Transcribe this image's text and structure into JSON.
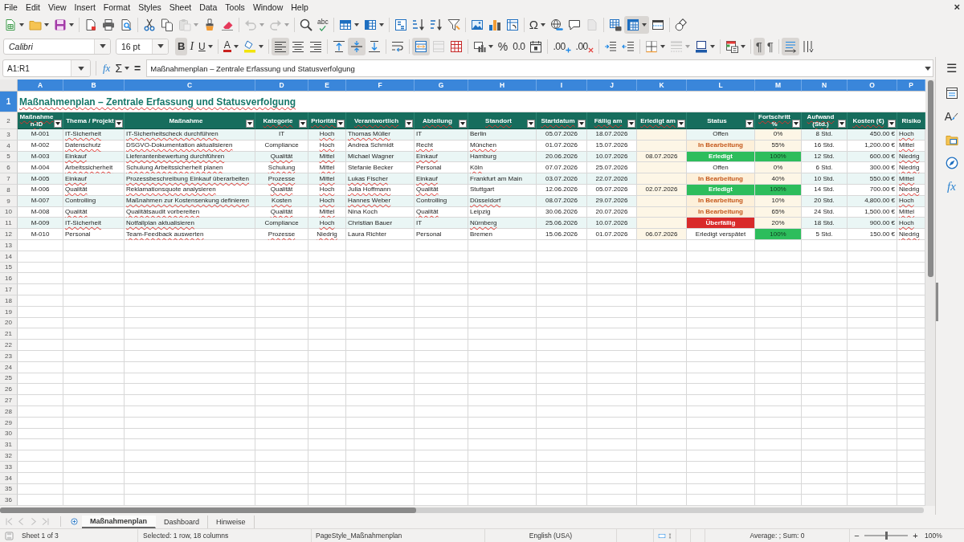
{
  "menu_bar": {
    "items": [
      "File",
      "Edit",
      "View",
      "Insert",
      "Format",
      "Styles",
      "Sheet",
      "Data",
      "Tools",
      "Window",
      "Help"
    ],
    "close": "×"
  },
  "standard_toolbar": [
    [
      {
        "kind": "new",
        "dropdown": true,
        "pressed": false,
        "disabled": false
      },
      {
        "kind": "open",
        "dropdown": true,
        "pressed": false,
        "disabled": false
      },
      {
        "kind": "save",
        "dropdown": true,
        "pressed": false,
        "disabled": false
      }
    ],
    [
      {
        "kind": "pdf",
        "dropdown": false,
        "pressed": false,
        "disabled": false
      },
      {
        "kind": "print",
        "dropdown": false,
        "pressed": false,
        "disabled": false
      },
      {
        "kind": "preview",
        "dropdown": false,
        "pressed": false,
        "disabled": false
      }
    ],
    [
      {
        "kind": "cut",
        "dropdown": false,
        "pressed": false,
        "disabled": false
      },
      {
        "kind": "copy",
        "dropdown": false,
        "pressed": false,
        "disabled": false
      },
      {
        "kind": "paste",
        "dropdown": true,
        "pressed": false,
        "disabled": true
      },
      {
        "kind": "clone",
        "dropdown": false,
        "pressed": false,
        "disabled": false
      },
      {
        "kind": "clear",
        "dropdown": false,
        "pressed": false,
        "disabled": false
      }
    ],
    [
      {
        "kind": "undo",
        "dropdown": true,
        "pressed": false,
        "disabled": true
      },
      {
        "kind": "redo",
        "dropdown": true,
        "pressed": false,
        "disabled": true
      }
    ],
    [
      {
        "kind": "find",
        "dropdown": false,
        "pressed": false,
        "disabled": false
      },
      {
        "kind": "spelling",
        "label": "abc",
        "dropdown": false,
        "pressed": false,
        "disabled": false
      }
    ],
    [
      {
        "kind": "rows",
        "dropdown": true,
        "pressed": false,
        "disabled": false
      },
      {
        "kind": "columns",
        "dropdown": true,
        "pressed": false,
        "disabled": false
      }
    ],
    [
      {
        "kind": "sort",
        "dropdown": false,
        "pressed": false,
        "disabled": false
      },
      {
        "kind": "sort_ascending",
        "dropdown": false,
        "pressed": false,
        "disabled": false
      },
      {
        "kind": "sort_descending",
        "dropdown": false,
        "pressed": false,
        "disabled": false
      },
      {
        "kind": "autofilter",
        "dropdown": false,
        "pressed": false,
        "disabled": false
      }
    ],
    [
      {
        "kind": "image",
        "dropdown": false,
        "pressed": false,
        "disabled": false
      },
      {
        "kind": "chart",
        "dropdown": false,
        "pressed": false,
        "disabled": false
      },
      {
        "kind": "pivot",
        "dropdown": false,
        "pressed": false,
        "disabled": false
      }
    ],
    [
      {
        "kind": "special_character",
        "label": "Ω",
        "dropdown": true,
        "pressed": false,
        "disabled": false
      },
      {
        "kind": "hyperlink",
        "dropdown": false,
        "pressed": false,
        "disabled": false
      },
      {
        "kind": "comment",
        "dropdown": false,
        "pressed": false,
        "disabled": false
      },
      {
        "kind": "header_footer",
        "dropdown": false,
        "pressed": false,
        "disabled": true
      }
    ],
    [
      {
        "kind": "print_area",
        "dropdown": false,
        "pressed": false,
        "disabled": false
      },
      {
        "kind": "freeze",
        "dropdown": true,
        "pressed": true,
        "disabled": false
      },
      {
        "kind": "split",
        "dropdown": false,
        "pressed": false,
        "disabled": false
      }
    ],
    [
      {
        "kind": "draw",
        "dropdown": false,
        "pressed": false,
        "disabled": false
      }
    ]
  ],
  "formatting_toolbar": {
    "font_name": "Calibri",
    "font_size": "16 pt",
    "groups": [
      [
        {
          "kind": "bold",
          "label": "B",
          "dropdown": false,
          "pressed": true,
          "disabled": false
        },
        {
          "kind": "italic",
          "label": "I",
          "dropdown": false,
          "pressed": false,
          "disabled": false
        },
        {
          "kind": "underline",
          "label": "U",
          "dropdown": true,
          "pressed": false,
          "disabled": false
        }
      ],
      [
        {
          "kind": "font_color",
          "label": "A",
          "dropdown": true,
          "pressed": false,
          "disabled": false
        },
        {
          "kind": "highlight",
          "dropdown": true,
          "pressed": false,
          "disabled": false
        }
      ],
      [
        {
          "kind": "align_left",
          "dropdown": false,
          "pressed": true,
          "disabled": false
        },
        {
          "kind": "align_center",
          "dropdown": false,
          "pressed": false,
          "disabled": false
        },
        {
          "kind": "align_right",
          "dropdown": false,
          "pressed": false,
          "disabled": false
        }
      ],
      [
        {
          "kind": "align_top",
          "dropdown": false,
          "pressed": false,
          "disabled": false
        },
        {
          "kind": "align_middle",
          "dropdown": false,
          "pressed": true,
          "disabled": false
        },
        {
          "kind": "align_bottom",
          "dropdown": false,
          "pressed": false,
          "disabled": false
        }
      ],
      [
        {
          "kind": "wrap",
          "dropdown": false,
          "pressed": false,
          "disabled": false
        }
      ],
      [
        {
          "kind": "merge_center",
          "dropdown": false,
          "pressed": true,
          "disabled": false
        },
        {
          "kind": "merge",
          "dropdown": false,
          "pressed": false,
          "disabled": true
        },
        {
          "kind": "unmerge",
          "dropdown": false,
          "pressed": false,
          "disabled": false
        }
      ],
      [
        {
          "kind": "currency",
          "dropdown": true,
          "pressed": false,
          "disabled": false
        },
        {
          "kind": "percent",
          "label": "%",
          "dropdown": false,
          "pressed": false,
          "disabled": false
        },
        {
          "kind": "number",
          "label": "0.0",
          "dropdown": false,
          "pressed": false,
          "disabled": false
        },
        {
          "kind": "date",
          "dropdown": false,
          "pressed": false,
          "disabled": false
        }
      ],
      [
        {
          "kind": "add_decimal",
          "label": ".00",
          "dropdown": false,
          "pressed": false,
          "disabled": false
        },
        {
          "kind": "delete_decimal",
          "label": ".00",
          "dropdown": false,
          "pressed": false,
          "disabled": false
        }
      ],
      [
        {
          "kind": "indent",
          "dropdown": false,
          "pressed": false,
          "disabled": false
        },
        {
          "kind": "outdent",
          "dropdown": false,
          "pressed": false,
          "disabled": false
        }
      ],
      [
        {
          "kind": "borders",
          "dropdown": true,
          "pressed": false,
          "disabled": false
        },
        {
          "kind": "border_style",
          "dropdown": true,
          "pressed": false,
          "disabled": true
        },
        {
          "kind": "border_color",
          "dropdown": true,
          "pressed": false,
          "disabled": false
        }
      ],
      [
        {
          "kind": "conditional",
          "dropdown": true,
          "pressed": false,
          "disabled": false
        }
      ],
      [
        {
          "kind": "paragraph_ltr",
          "label": "¶",
          "dropdown": false,
          "pressed": true,
          "disabled": false
        },
        {
          "kind": "paragraph_rtl",
          "label": "¶",
          "dropdown": false,
          "pressed": false,
          "disabled": false
        }
      ],
      [
        {
          "kind": "text_ltr",
          "dropdown": false,
          "pressed": true,
          "disabled": false
        },
        {
          "kind": "text_vertical",
          "dropdown": false,
          "pressed": false,
          "disabled": false
        }
      ]
    ]
  },
  "formula_bar": {
    "name_box": "A1:R1",
    "function_wizard": "fx",
    "sum": "Σ",
    "equals": "=",
    "content": "Maßnahmenplan – Zentrale Erfassung und Statusverfolgung"
  },
  "sidebar": {
    "menu": "☰",
    "buttons": [
      {
        "kind": "properties"
      },
      {
        "kind": "styles",
        "label": "A"
      },
      {
        "kind": "gallery"
      },
      {
        "kind": "navigator"
      },
      {
        "kind": "functions",
        "label": "fx"
      }
    ]
  },
  "sheet": {
    "column_headers": [
      {
        "label": "A",
        "selected": true
      },
      {
        "label": "B",
        "selected": true
      },
      {
        "label": "C",
        "selected": true
      },
      {
        "label": "D",
        "selected": true
      },
      {
        "label": "E",
        "selected": true
      },
      {
        "label": "F",
        "selected": true
      },
      {
        "label": "G",
        "selected": true
      },
      {
        "label": "H",
        "selected": true
      },
      {
        "label": "I",
        "selected": true
      },
      {
        "label": "J",
        "selected": true
      },
      {
        "label": "K",
        "selected": true
      },
      {
        "label": "L",
        "selected": true
      },
      {
        "label": "M",
        "selected": true
      },
      {
        "label": "N",
        "selected": true
      },
      {
        "label": "O",
        "selected": true
      },
      {
        "label": "P",
        "selected": true
      }
    ],
    "row_headers": [
      {
        "label": "1",
        "selected": true
      },
      {
        "label": "2",
        "selected": false
      },
      {
        "label": "3",
        "selected": false
      },
      {
        "label": "4",
        "selected": false
      },
      {
        "label": "5",
        "selected": false
      },
      {
        "label": "6",
        "selected": false
      },
      {
        "label": "7",
        "selected": false
      },
      {
        "label": "8",
        "selected": false
      },
      {
        "label": "9",
        "selected": false
      },
      {
        "label": "10",
        "selected": false
      },
      {
        "label": "11",
        "selected": false
      },
      {
        "label": "12",
        "selected": false
      },
      {
        "label": "13",
        "selected": false
      },
      {
        "label": "14",
        "selected": false
      },
      {
        "label": "15",
        "selected": false
      },
      {
        "label": "16",
        "selected": false
      },
      {
        "label": "17",
        "selected": false
      },
      {
        "label": "18",
        "selected": false
      },
      {
        "label": "19",
        "selected": false
      },
      {
        "label": "20",
        "selected": false
      },
      {
        "label": "21",
        "selected": false
      },
      {
        "label": "22",
        "selected": false
      },
      {
        "label": "23",
        "selected": false
      },
      {
        "label": "24",
        "selected": false
      },
      {
        "label": "25",
        "selected": false
      },
      {
        "label": "26",
        "selected": false
      },
      {
        "label": "27",
        "selected": false
      },
      {
        "label": "28",
        "selected": false
      },
      {
        "label": "29",
        "selected": false
      },
      {
        "label": "30",
        "selected": false
      },
      {
        "label": "31",
        "selected": false
      },
      {
        "label": "32",
        "selected": false
      },
      {
        "label": "33",
        "selected": false
      },
      {
        "label": "34",
        "selected": false
      },
      {
        "label": "35",
        "selected": false
      },
      {
        "label": "36",
        "selected": false
      }
    ],
    "title": {
      "text": "Maßnahmenplan – Zentrale Erfassung und Statusverfolgung",
      "spell_error": true
    },
    "headers": [
      {
        "text": "Maßnahmen-ID",
        "filter": true,
        "spell_error": true
      },
      {
        "text": "Thema / Projekt",
        "filter": true,
        "spell_error": false
      },
      {
        "text": "Maßnahme",
        "filter": true,
        "spell_error": false
      },
      {
        "text": "Kategorie",
        "filter": true,
        "spell_error": true
      },
      {
        "text": "Priorität",
        "filter": true,
        "spell_error": true
      },
      {
        "text": "Verantwortlich",
        "filter": true,
        "spell_error": true
      },
      {
        "text": "Abteilung",
        "filter": true,
        "spell_error": true
      },
      {
        "text": "Standort",
        "filter": true,
        "spell_error": true
      },
      {
        "text": "Startdatum",
        "filter": true,
        "spell_error": true
      },
      {
        "text": "Fällig am",
        "filter": true,
        "spell_error": true
      },
      {
        "text": "Erledigt am",
        "filter": true,
        "spell_error": true
      },
      {
        "text": "Status",
        "filter": true,
        "spell_error": false
      },
      {
        "text": "Fortschritt %",
        "filter": true,
        "spell_error": true
      },
      {
        "text": "Aufwand (Std.)",
        "filter": true,
        "spell_error": true
      },
      {
        "text": "Kosten (€)",
        "filter": true,
        "spell_error": true
      },
      {
        "text": "Risiko",
        "filter": false,
        "spell_error": false
      }
    ],
    "rows": [
      {
        "id": {
          "text": "M-001",
          "spell_error": false
        },
        "topic": {
          "text": "IT-Sicherheit",
          "spell_error": true
        },
        "measure": {
          "text": "IT-Sicherheitscheck durchführen",
          "spell_error": true
        },
        "category": {
          "text": "IT",
          "spell_error": false
        },
        "priority": {
          "text": "Hoch",
          "spell_error": true
        },
        "owner": {
          "text": "Thomas Müller",
          "spell_error": true
        },
        "department": {
          "text": "IT",
          "spell_error": false
        },
        "location": {
          "text": "Berlin",
          "spell_error": false
        },
        "start": {
          "text": "05.07.2026",
          "spell_error": false
        },
        "due": {
          "text": "18.07.2026",
          "spell_error": false
        },
        "status": {
          "text": "Offen",
          "spell_error": false,
          "kind": "open"
        },
        "progress": {
          "text": "0%",
          "spell_error": false,
          "complete": false
        },
        "effort": {
          "text": "8 Std.",
          "spell_error": false
        },
        "cost": {
          "text": "450.00 €",
          "spell_error": false
        },
        "risk": {
          "text": "Hoch",
          "spell_error": true
        }
      },
      {
        "id": {
          "text": "M-002",
          "spell_error": false
        },
        "topic": {
          "text": "Datenschutz",
          "spell_error": true
        },
        "measure": {
          "text": "DSGVO-Dokumentation aktualisieren",
          "spell_error": true
        },
        "category": {
          "text": "Compliance",
          "spell_error": false
        },
        "priority": {
          "text": "Hoch",
          "spell_error": true
        },
        "owner": {
          "text": "Andrea Schmidt",
          "spell_error": false
        },
        "department": {
          "text": "Recht",
          "spell_error": true
        },
        "location": {
          "text": "München",
          "spell_error": true
        },
        "start": {
          "text": "01.07.2026",
          "spell_error": false
        },
        "due": {
          "text": "15.07.2026",
          "spell_error": false
        },
        "status": {
          "text": "In Bearbeitung",
          "spell_error": false,
          "kind": "in_progress"
        },
        "progress": {
          "text": "55%",
          "spell_error": false,
          "complete": false
        },
        "effort": {
          "text": "16 Std.",
          "spell_error": false
        },
        "cost": {
          "text": "1,200.00 €",
          "spell_error": false
        },
        "risk": {
          "text": "Mittel",
          "spell_error": true
        }
      },
      {
        "id": {
          "text": "M-003",
          "spell_error": false
        },
        "topic": {
          "text": "Einkauf",
          "spell_error": true
        },
        "measure": {
          "text": "Lieferantenbewertung durchführen",
          "spell_error": true
        },
        "category": {
          "text": "Qualität",
          "spell_error": true
        },
        "priority": {
          "text": "Mittel",
          "spell_error": true
        },
        "owner": {
          "text": "Michael Wagner",
          "spell_error": false
        },
        "department": {
          "text": "Einkauf",
          "spell_error": true
        },
        "location": {
          "text": "Hamburg",
          "spell_error": false
        },
        "start": {
          "text": "20.06.2026",
          "spell_error": false
        },
        "due": {
          "text": "10.07.2026",
          "spell_error": false
        },
        "done_on": {
          "text": "08.07.2026",
          "spell_error": false
        },
        "status": {
          "text": "Erledigt",
          "spell_error": false,
          "kind": "done"
        },
        "progress": {
          "text": "100%",
          "spell_error": false,
          "complete": true
        },
        "effort": {
          "text": "12 Std.",
          "spell_error": false
        },
        "cost": {
          "text": "600.00 €",
          "spell_error": false
        },
        "risk": {
          "text": "Niedrig",
          "spell_error": true
        }
      },
      {
        "id": {
          "text": "M-004",
          "spell_error": false
        },
        "topic": {
          "text": "Arbeitssicherheit",
          "spell_error": true
        },
        "measure": {
          "text": "Schulung Arbeitssicherheit planen",
          "spell_error": true
        },
        "category": {
          "text": "Schulung",
          "spell_error": true
        },
        "priority": {
          "text": "Mittel",
          "spell_error": true
        },
        "owner": {
          "text": "Stefanie Becker",
          "spell_error": false
        },
        "department": {
          "text": "Personal",
          "spell_error": false
        },
        "location": {
          "text": "Köln",
          "spell_error": true
        },
        "start": {
          "text": "07.07.2026",
          "spell_error": false
        },
        "due": {
          "text": "25.07.2026",
          "spell_error": false
        },
        "status": {
          "text": "Offen",
          "spell_error": false,
          "kind": "open"
        },
        "progress": {
          "text": "0%",
          "spell_error": false,
          "complete": false
        },
        "effort": {
          "text": "6 Std.",
          "spell_error": false
        },
        "cost": {
          "text": "300.00 €",
          "spell_error": false
        },
        "risk": {
          "text": "Niedrig",
          "spell_error": true
        }
      },
      {
        "id": {
          "text": "M-005",
          "spell_error": false
        },
        "topic": {
          "text": "Einkauf",
          "spell_error": true
        },
        "measure": {
          "text": "Prozessbeschreibung Einkauf überarbeiten",
          "spell_error": true
        },
        "category": {
          "text": "Prozesse",
          "spell_error": true
        },
        "priority": {
          "text": "Mittel",
          "spell_error": true
        },
        "owner": {
          "text": "Lukas Fischer",
          "spell_error": true
        },
        "department": {
          "text": "Einkauf",
          "spell_error": true
        },
        "location": {
          "text": "Frankfurt am Main",
          "spell_error": false
        },
        "start": {
          "text": "03.07.2026",
          "spell_error": false
        },
        "due": {
          "text": "22.07.2026",
          "spell_error": false
        },
        "status": {
          "text": "In Bearbeitung",
          "spell_error": false,
          "kind": "in_progress"
        },
        "progress": {
          "text": "40%",
          "spell_error": false,
          "complete": false
        },
        "effort": {
          "text": "10 Std.",
          "spell_error": false
        },
        "cost": {
          "text": "550.00 €",
          "spell_error": false
        },
        "risk": {
          "text": "Mittel",
          "spell_error": true
        }
      },
      {
        "id": {
          "text": "M-006",
          "spell_error": false
        },
        "topic": {
          "text": "Qualität",
          "spell_error": true
        },
        "measure": {
          "text": "Reklamationsquote analysieren",
          "spell_error": true
        },
        "category": {
          "text": "Qualität",
          "spell_error": true
        },
        "priority": {
          "text": "Hoch",
          "spell_error": true
        },
        "owner": {
          "text": "Julia Hoffmann",
          "spell_error": true
        },
        "department": {
          "text": "Qualität",
          "spell_error": true
        },
        "location": {
          "text": "Stuttgart",
          "spell_error": false
        },
        "start": {
          "text": "12.06.2026",
          "spell_error": false
        },
        "due": {
          "text": "05.07.2026",
          "spell_error": false
        },
        "done_on": {
          "text": "02.07.2026",
          "spell_error": false
        },
        "status": {
          "text": "Erledigt",
          "spell_error": false,
          "kind": "done"
        },
        "progress": {
          "text": "100%",
          "spell_error": false,
          "complete": true
        },
        "effort": {
          "text": "14 Std.",
          "spell_error": false
        },
        "cost": {
          "text": "700.00 €",
          "spell_error": false
        },
        "risk": {
          "text": "Niedrig",
          "spell_error": true
        }
      },
      {
        "id": {
          "text": "M-007",
          "spell_error": false
        },
        "topic": {
          "text": "Controlling",
          "spell_error": false
        },
        "measure": {
          "text": "Maßnahmen zur Kostensenkung definieren",
          "spell_error": true
        },
        "category": {
          "text": "Kosten",
          "spell_error": true
        },
        "priority": {
          "text": "Hoch",
          "spell_error": true
        },
        "owner": {
          "text": "Hannes Weber",
          "spell_error": true
        },
        "department": {
          "text": "Controlling",
          "spell_error": false
        },
        "location": {
          "text": "Düsseldorf",
          "spell_error": true
        },
        "start": {
          "text": "08.07.2026",
          "spell_error": false
        },
        "due": {
          "text": "29.07.2026",
          "spell_error": false
        },
        "status": {
          "text": "In Bearbeitung",
          "spell_error": false,
          "kind": "in_progress"
        },
        "progress": {
          "text": "10%",
          "spell_error": false,
          "complete": false
        },
        "effort": {
          "text": "20 Std.",
          "spell_error": false
        },
        "cost": {
          "text": "4,800.00 €",
          "spell_error": false
        },
        "risk": {
          "text": "Hoch",
          "spell_error": true
        }
      },
      {
        "id": {
          "text": "M-008",
          "spell_error": false
        },
        "topic": {
          "text": "Qualität",
          "spell_error": true
        },
        "measure": {
          "text": "Qualitätsaudit vorbereiten",
          "spell_error": true
        },
        "category": {
          "text": "Qualität",
          "spell_error": true
        },
        "priority": {
          "text": "Mittel",
          "spell_error": true
        },
        "owner": {
          "text": "Nina Koch",
          "spell_error": false
        },
        "department": {
          "text": "Qualität",
          "spell_error": true
        },
        "location": {
          "text": "Leipzig",
          "spell_error": false
        },
        "start": {
          "text": "30.06.2026",
          "spell_error": false
        },
        "due": {
          "text": "20.07.2026",
          "spell_error": false
        },
        "status": {
          "text": "In Bearbeitung",
          "spell_error": false,
          "kind": "in_progress"
        },
        "progress": {
          "text": "65%",
          "spell_error": false,
          "complete": false
        },
        "effort": {
          "text": "24 Std.",
          "spell_error": false
        },
        "cost": {
          "text": "1,500.00 €",
          "spell_error": false
        },
        "risk": {
          "text": "Mittel",
          "spell_error": true
        }
      },
      {
        "id": {
          "text": "M-009",
          "spell_error": false
        },
        "topic": {
          "text": "IT-Sicherheit",
          "spell_error": true
        },
        "measure": {
          "text": "Notfallplan aktualisieren",
          "spell_error": true
        },
        "category": {
          "text": "Compliance",
          "spell_error": false
        },
        "priority": {
          "text": "Hoch",
          "spell_error": true
        },
        "owner": {
          "text": "Christian Bauer",
          "spell_error": false
        },
        "department": {
          "text": "IT",
          "spell_error": false
        },
        "location": {
          "text": "Nürnberg",
          "spell_error": true
        },
        "start": {
          "text": "25.06.2026",
          "spell_error": false
        },
        "due": {
          "text": "10.07.2026",
          "spell_error": false
        },
        "status": {
          "text": "Überfällig",
          "spell_error": false,
          "kind": "overdue"
        },
        "progress": {
          "text": "20%",
          "spell_error": false,
          "complete": false
        },
        "effort": {
          "text": "18 Std.",
          "spell_error": false
        },
        "cost": {
          "text": "900.00 €",
          "spell_error": false
        },
        "risk": {
          "text": "Hoch",
          "spell_error": true
        }
      },
      {
        "id": {
          "text": "M-010",
          "spell_error": false
        },
        "topic": {
          "text": "Personal",
          "spell_error": false
        },
        "measure": {
          "text": "Team-Feedback auswerten",
          "spell_error": true
        },
        "category": {
          "text": "Prozesse",
          "spell_error": true
        },
        "priority": {
          "text": "Niedrig",
          "spell_error": true
        },
        "owner": {
          "text": "Laura Richter",
          "spell_error": false
        },
        "department": {
          "text": "Personal",
          "spell_error": false
        },
        "location": {
          "text": "Bremen",
          "spell_error": false
        },
        "start": {
          "text": "15.06.2026",
          "spell_error": false
        },
        "due": {
          "text": "01.07.2026",
          "spell_error": false
        },
        "done_on": {
          "text": "06.07.2026",
          "spell_error": false
        },
        "status": {
          "text": "Erledigt verspätet",
          "spell_error": false,
          "kind": "late"
        },
        "progress": {
          "text": "100%",
          "spell_error": false,
          "complete": true
        },
        "effort": {
          "text": "5 Std.",
          "spell_error": false
        },
        "cost": {
          "text": "150.00 €",
          "spell_error": false
        },
        "risk": {
          "text": "Niedrig",
          "spell_error": true
        }
      }
    ]
  },
  "sheet_tabs": {
    "navigation": [
      {
        "kind": "first",
        "disabled": true
      },
      {
        "kind": "previous",
        "disabled": true
      },
      {
        "kind": "next",
        "disabled": true
      },
      {
        "kind": "last",
        "disabled": true
      }
    ],
    "tabs": [
      {
        "label": "Maßnahmenplan",
        "selected": true
      },
      {
        "label": "Dashboard",
        "selected": false
      },
      {
        "label": "Hinweise",
        "selected": false
      }
    ]
  },
  "status_bar": {
    "sheet_position": "Sheet 1 of 3",
    "selection": "Selected: 1 row, 18 columns",
    "page_style": "PageStyle_Maßnahmenplan",
    "language": "English (USA)",
    "summary": "Average: ; Sum: 0",
    "zoom_out": "−",
    "zoom_slider": {
      "level": 0.5
    },
    "zoom_in": "+",
    "zoom": "100%"
  }
}
